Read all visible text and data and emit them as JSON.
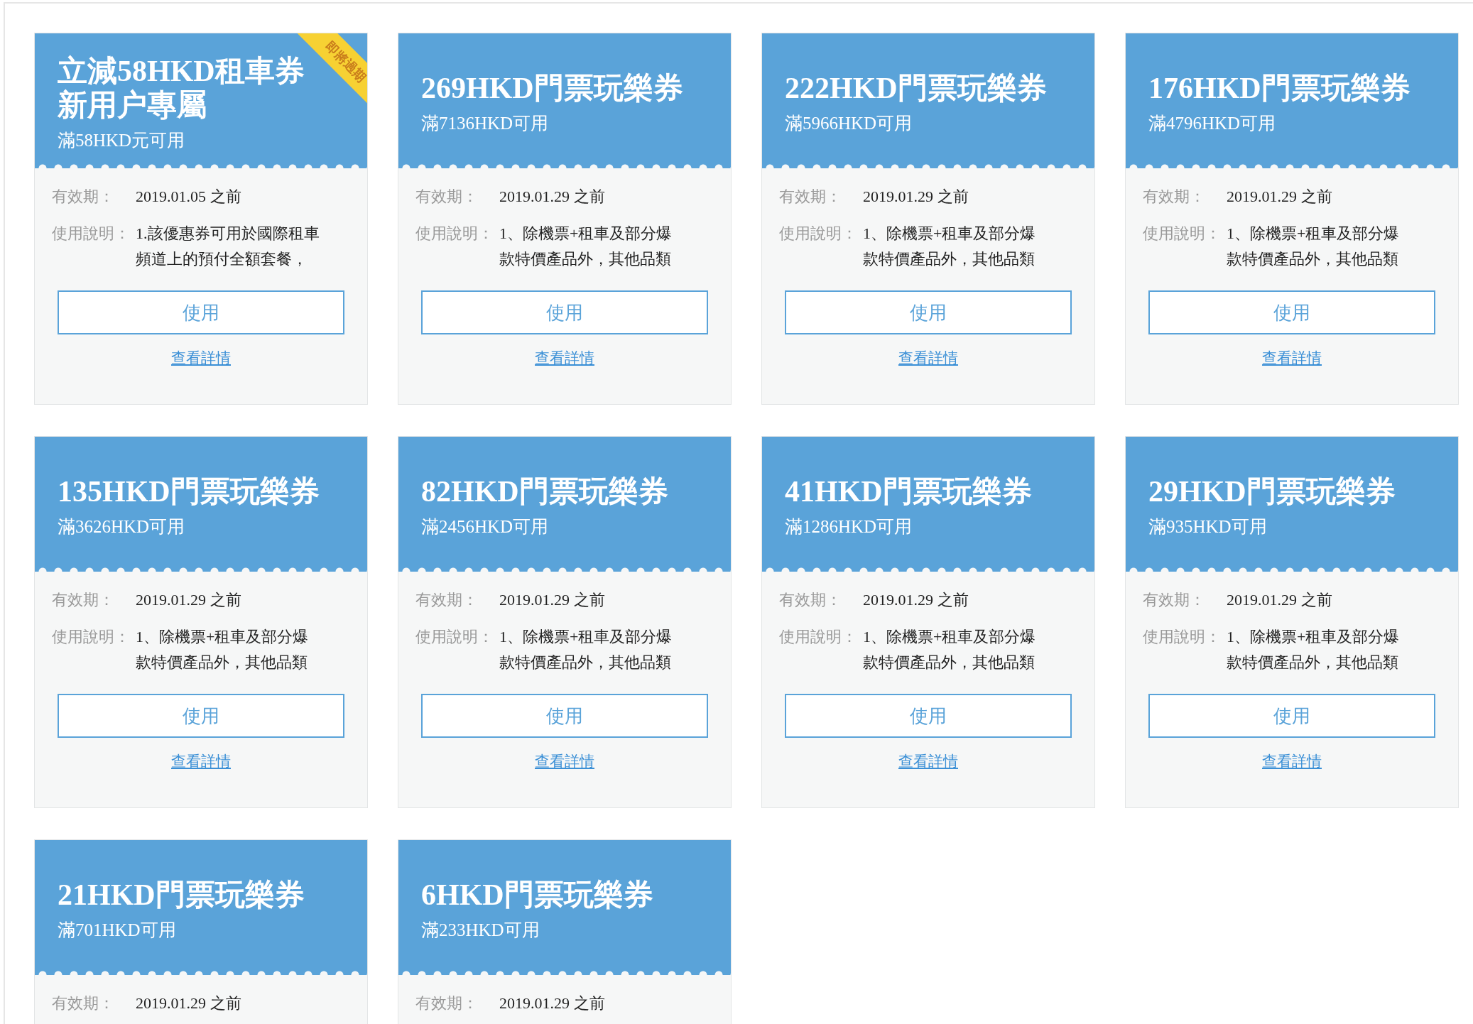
{
  "coupons": [
    {
      "title_lines": [
        "立減58HKD租車券",
        "新用户專屬"
      ],
      "subtitle": "滿58HKD元可用",
      "ribbon": "即將過期",
      "validity_label": "有效期：",
      "validity": "2019.01.05 之前",
      "usage_label": "使用說明：",
      "usage_lines": [
        "1.該優惠券可用於國際租車",
        "頻道上的預付全額套餐，"
      ],
      "button": "使用",
      "link": "查看詳情"
    },
    {
      "title_lines": [
        "269HKD門票玩樂券"
      ],
      "subtitle": "滿7136HKD可用",
      "validity_label": "有效期：",
      "validity": "2019.01.29 之前",
      "usage_label": "使用說明：",
      "usage_lines": [
        "1、除機票+租車及部分爆",
        "款特價產品外，其他品類"
      ],
      "button": "使用",
      "link": "查看詳情"
    },
    {
      "title_lines": [
        "222HKD門票玩樂券"
      ],
      "subtitle": "滿5966HKD可用",
      "validity_label": "有效期：",
      "validity": "2019.01.29 之前",
      "usage_label": "使用說明：",
      "usage_lines": [
        "1、除機票+租車及部分爆",
        "款特價產品外，其他品類"
      ],
      "button": "使用",
      "link": "查看詳情"
    },
    {
      "title_lines": [
        "176HKD門票玩樂券"
      ],
      "subtitle": "滿4796HKD可用",
      "validity_label": "有效期：",
      "validity": "2019.01.29 之前",
      "usage_label": "使用說明：",
      "usage_lines": [
        "1、除機票+租車及部分爆",
        "款特價產品外，其他品類"
      ],
      "button": "使用",
      "link": "查看詳情"
    },
    {
      "title_lines": [
        "135HKD門票玩樂券"
      ],
      "subtitle": "滿3626HKD可用",
      "validity_label": "有效期：",
      "validity": "2019.01.29 之前",
      "usage_label": "使用說明：",
      "usage_lines": [
        "1、除機票+租車及部分爆",
        "款特價產品外，其他品類"
      ],
      "button": "使用",
      "link": "查看詳情"
    },
    {
      "title_lines": [
        "82HKD門票玩樂券"
      ],
      "subtitle": "滿2456HKD可用",
      "validity_label": "有效期：",
      "validity": "2019.01.29 之前",
      "usage_label": "使用說明：",
      "usage_lines": [
        "1、除機票+租車及部分爆",
        "款特價產品外，其他品類"
      ],
      "button": "使用",
      "link": "查看詳情"
    },
    {
      "title_lines": [
        "41HKD門票玩樂券"
      ],
      "subtitle": "滿1286HKD可用",
      "validity_label": "有效期：",
      "validity": "2019.01.29 之前",
      "usage_label": "使用說明：",
      "usage_lines": [
        "1、除機票+租車及部分爆",
        "款特價產品外，其他品類"
      ],
      "button": "使用",
      "link": "查看詳情"
    },
    {
      "title_lines": [
        "29HKD門票玩樂券"
      ],
      "subtitle": "滿935HKD可用",
      "validity_label": "有效期：",
      "validity": "2019.01.29 之前",
      "usage_label": "使用說明：",
      "usage_lines": [
        "1、除機票+租車及部分爆",
        "款特價產品外，其他品類"
      ],
      "button": "使用",
      "link": "查看詳情"
    },
    {
      "title_lines": [
        "21HKD門票玩樂券"
      ],
      "subtitle": "滿701HKD可用",
      "validity_label": "有效期：",
      "validity": "2019.01.29 之前"
    },
    {
      "title_lines": [
        "6HKD門票玩樂券"
      ],
      "subtitle": "滿233HKD可用",
      "validity_label": "有效期：",
      "validity": "2019.01.29 之前"
    }
  ]
}
